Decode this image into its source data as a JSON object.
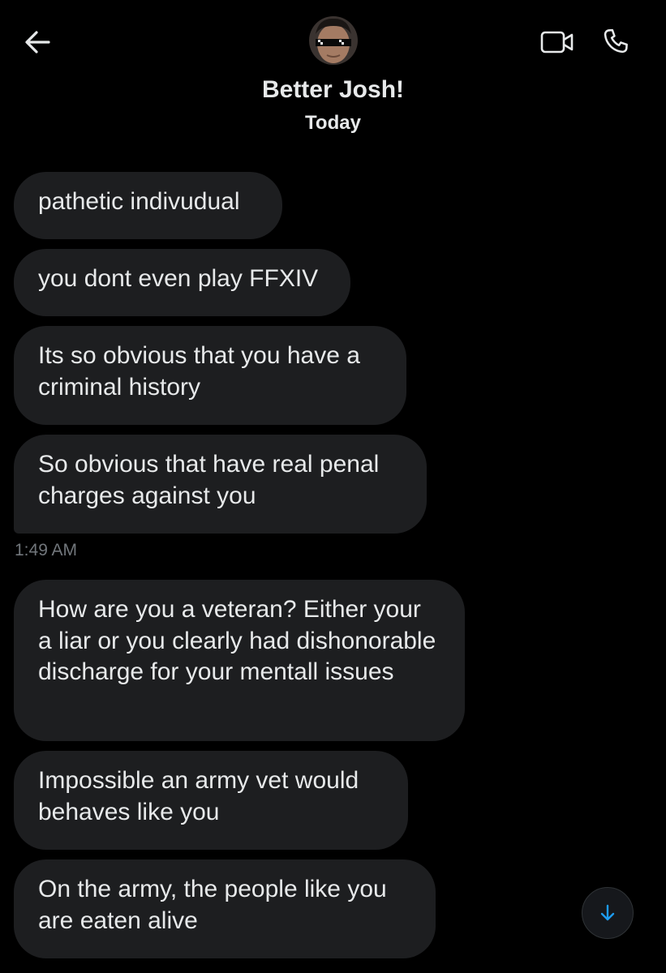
{
  "header": {
    "title": "Better Josh!",
    "day_label": "Today"
  },
  "messages": [
    {
      "text": "pathetic indivudual"
    },
    {
      "text": "you dont even play FFXIV"
    },
    {
      "text": "Its so obvious that you have a criminal history"
    },
    {
      "text": "So obvious that have real penal charges against you"
    },
    {
      "text": "How are you a veteran? Either your a liar or you clearly had dishonorable discharge for your mentall issues"
    },
    {
      "text": "Impossible an army vet would behaves like you"
    },
    {
      "text": "On the army, the people like you are eaten alive"
    }
  ],
  "timestamp": "1:49 AM",
  "icons": {
    "back": "back-arrow-icon",
    "video": "video-camera-icon",
    "call": "phone-icon",
    "scroll_down": "arrow-down-icon"
  },
  "colors": {
    "background": "#000000",
    "bubble": "#1d1e20",
    "text": "#e7e9ea",
    "muted": "#71767b",
    "accent": "#1d9bf0"
  }
}
